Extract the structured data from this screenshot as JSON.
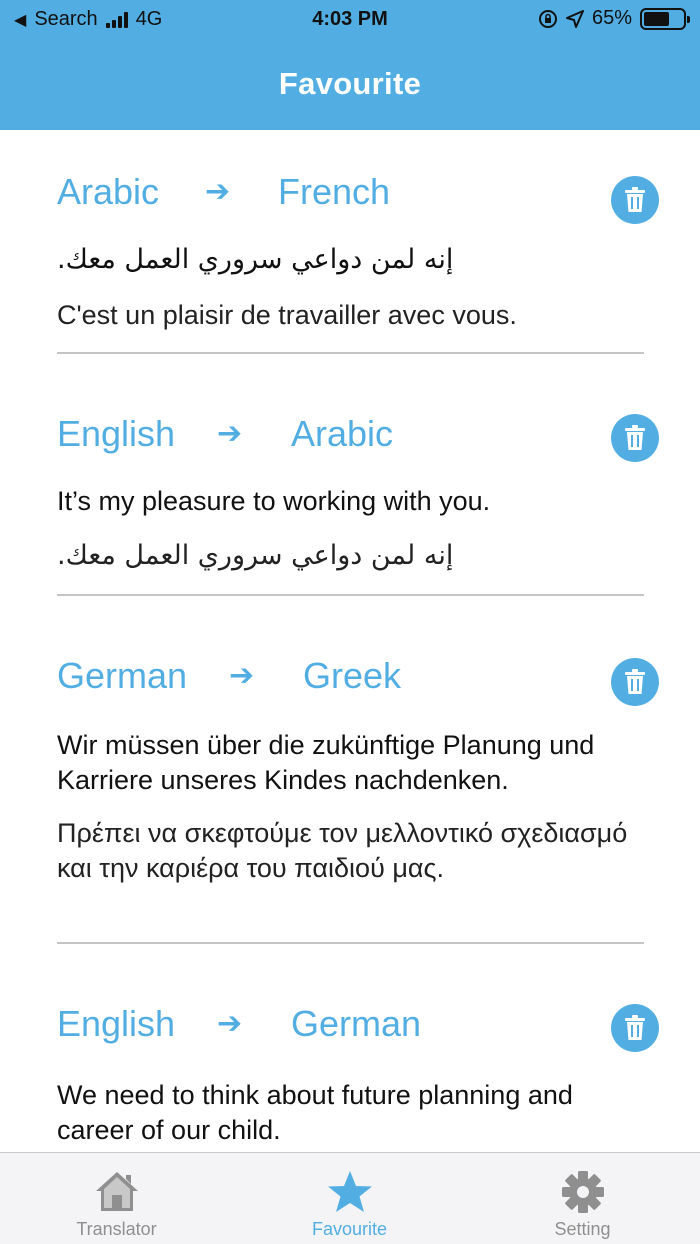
{
  "status_bar": {
    "back_label": "Search",
    "network": "4G",
    "time": "4:03 PM",
    "battery": "65%",
    "battery_level": 0.65
  },
  "header": {
    "title": "Favourite"
  },
  "favourites": [
    {
      "from": "Arabic",
      "to": "French",
      "source_text": "إنه لمن دواعي سروري العمل معك.",
      "translated_text": "C'est un plaisir de travailler avec vous."
    },
    {
      "from": "English",
      "to": "Arabic",
      "source_text": "It’s my pleasure to working with you.",
      "translated_text": "إنه لمن دواعي سروري العمل معك."
    },
    {
      "from": "German",
      "to": "Greek",
      "source_text": "Wir müssen über die zukünftige Planung und Karriere unseres Kindes nachdenken.",
      "translated_text": "Πρέπει να σκεφτούμε τον μελλοντικό σχεδιασμό και την καριέρα του παιδιού μας."
    },
    {
      "from": "English",
      "to": "German",
      "source_text": "We need to think about future planning and career of our child.",
      "translated_text": ""
    }
  ],
  "icons": {
    "arrow": "arrow-right-icon",
    "delete": "trash-icon",
    "tab_translator": "home-icon",
    "tab_favourite": "star-icon",
    "tab_setting": "gear-icon"
  },
  "tabs": [
    {
      "label": "Translator",
      "active": false
    },
    {
      "label": "Favourite",
      "active": true
    },
    {
      "label": "Setting",
      "active": false
    }
  ],
  "colors": {
    "accent": "#52aee2",
    "inactive_tab": "#8f8f8f",
    "divider": "#c4c4c4"
  }
}
